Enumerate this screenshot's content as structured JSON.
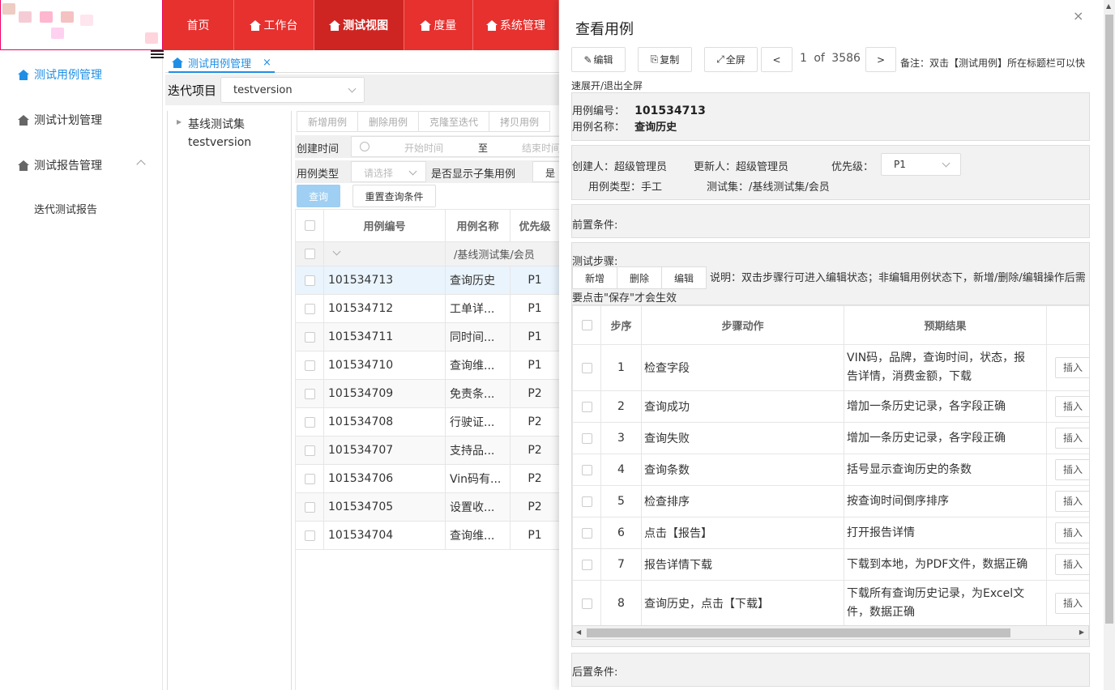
{
  "header": {
    "nav_tabs": [
      {
        "label": "首页"
      },
      {
        "label": "工作台"
      },
      {
        "label": "测试视图"
      },
      {
        "label": "度量"
      },
      {
        "label": "系统管理"
      }
    ]
  },
  "sidebar": {
    "items": [
      {
        "label": "测试用例管理"
      },
      {
        "label": "测试计划管理"
      },
      {
        "label": "测试报告管理"
      }
    ],
    "sub_items": [
      {
        "label": "迭代测试报告"
      }
    ]
  },
  "tabs": {
    "active_label": "测试用例管理",
    "close": "×"
  },
  "iteration": {
    "label": "迭代项目",
    "value": "testversion"
  },
  "tree": {
    "root": "基线测试集",
    "child": "testversion"
  },
  "toolbar": {
    "buttons": [
      "新增用例",
      "删除用例",
      "克隆至迭代",
      "拷贝用例"
    ]
  },
  "filters": {
    "created_label": "创建时间",
    "start_placeholder": "开始时间",
    "to": "至",
    "end_placeholder": "结束时间",
    "type_label": "用例类型",
    "type_placeholder": "请选择",
    "sub_label": "是否显示子集用例",
    "sub_value": "是",
    "query": "查询",
    "reset": "重置查询条件"
  },
  "case_table": {
    "headers": [
      "用例编号",
      "用例名称",
      "优先级"
    ],
    "group": "/基线测试集/会员",
    "rows": [
      {
        "id": "101534713",
        "name": "查询历史",
        "priority": "P1"
      },
      {
        "id": "101534712",
        "name": "工单详...",
        "priority": "P1"
      },
      {
        "id": "101534711",
        "name": "同时间...",
        "priority": "P1"
      },
      {
        "id": "101534710",
        "name": "查询维...",
        "priority": "P1"
      },
      {
        "id": "101534709",
        "name": "免责条...",
        "priority": "P2"
      },
      {
        "id": "101534708",
        "name": "行驶证...",
        "priority": "P2"
      },
      {
        "id": "101534707",
        "name": "支持品...",
        "priority": "P2"
      },
      {
        "id": "101534706",
        "name": "Vin码有...",
        "priority": "P2"
      },
      {
        "id": "101534705",
        "name": "设置收...",
        "priority": "P2"
      },
      {
        "id": "101534704",
        "name": "查询维...",
        "priority": "P1"
      }
    ]
  },
  "drawer": {
    "title": "查看用例",
    "close": "×",
    "buttons": {
      "edit": "编辑",
      "copy": "复制",
      "fullscreen": "全屏",
      "prev": "<",
      "next": ">"
    },
    "pager": "1 of 3586",
    "remark": "备注：双击【测试用例】所在标题栏可以快速展开/退出全屏",
    "case_id_label": "用例编号：",
    "case_id": "101534713",
    "case_name_label": "用例名称：",
    "case_name": "查询历史",
    "creator_label": "创建人：",
    "creator": "超级管理员",
    "updater_label": "更新人：",
    "updater": "超级管理员",
    "priority_label": "优先级：",
    "priority": "P1",
    "type_label": "用例类型：",
    "type": "手工",
    "suite_label": "测试集：",
    "suite": "/基线测试集/会员",
    "precondition_label": "前置条件:",
    "steps_label": "测试步骤:",
    "step_buttons": [
      "新增",
      "删除",
      "编辑"
    ],
    "steps_desc": "说明：双击步骤行可进入编辑状态；非编辑用例状态下，新增/删除/编辑操作后需要点击\"保存\"才会生效",
    "steps_headers": [
      "步序",
      "步骤动作",
      "预期结果"
    ],
    "insert_label": "插入",
    "steps": [
      {
        "no": "1",
        "action": "检查字段",
        "result": "VIN码，品牌，查询时间，状态，报告详情，消费金额，下载"
      },
      {
        "no": "2",
        "action": "查询成功",
        "result": "增加一条历史记录，各字段正确"
      },
      {
        "no": "3",
        "action": "查询失败",
        "result": "增加一条历史记录，各字段正确"
      },
      {
        "no": "4",
        "action": "查询条数",
        "result": "括号显示查询历史的条数"
      },
      {
        "no": "5",
        "action": "检查排序",
        "result": "按查询时间倒序排序"
      },
      {
        "no": "6",
        "action": "点击【报告】",
        "result": "打开报告详情"
      },
      {
        "no": "7",
        "action": "报告详情下载",
        "result": "下载到本地，为PDF文件，数据正确"
      },
      {
        "no": "8",
        "action": "查询历史，点击【下载】",
        "result": "下载所有查询历史记录，为Excel文件，数据正确"
      }
    ],
    "postcondition_label": "后置条件:"
  },
  "colors": {
    "nav_red": "#e6312f",
    "accent_blue": "#1f8fe6"
  }
}
